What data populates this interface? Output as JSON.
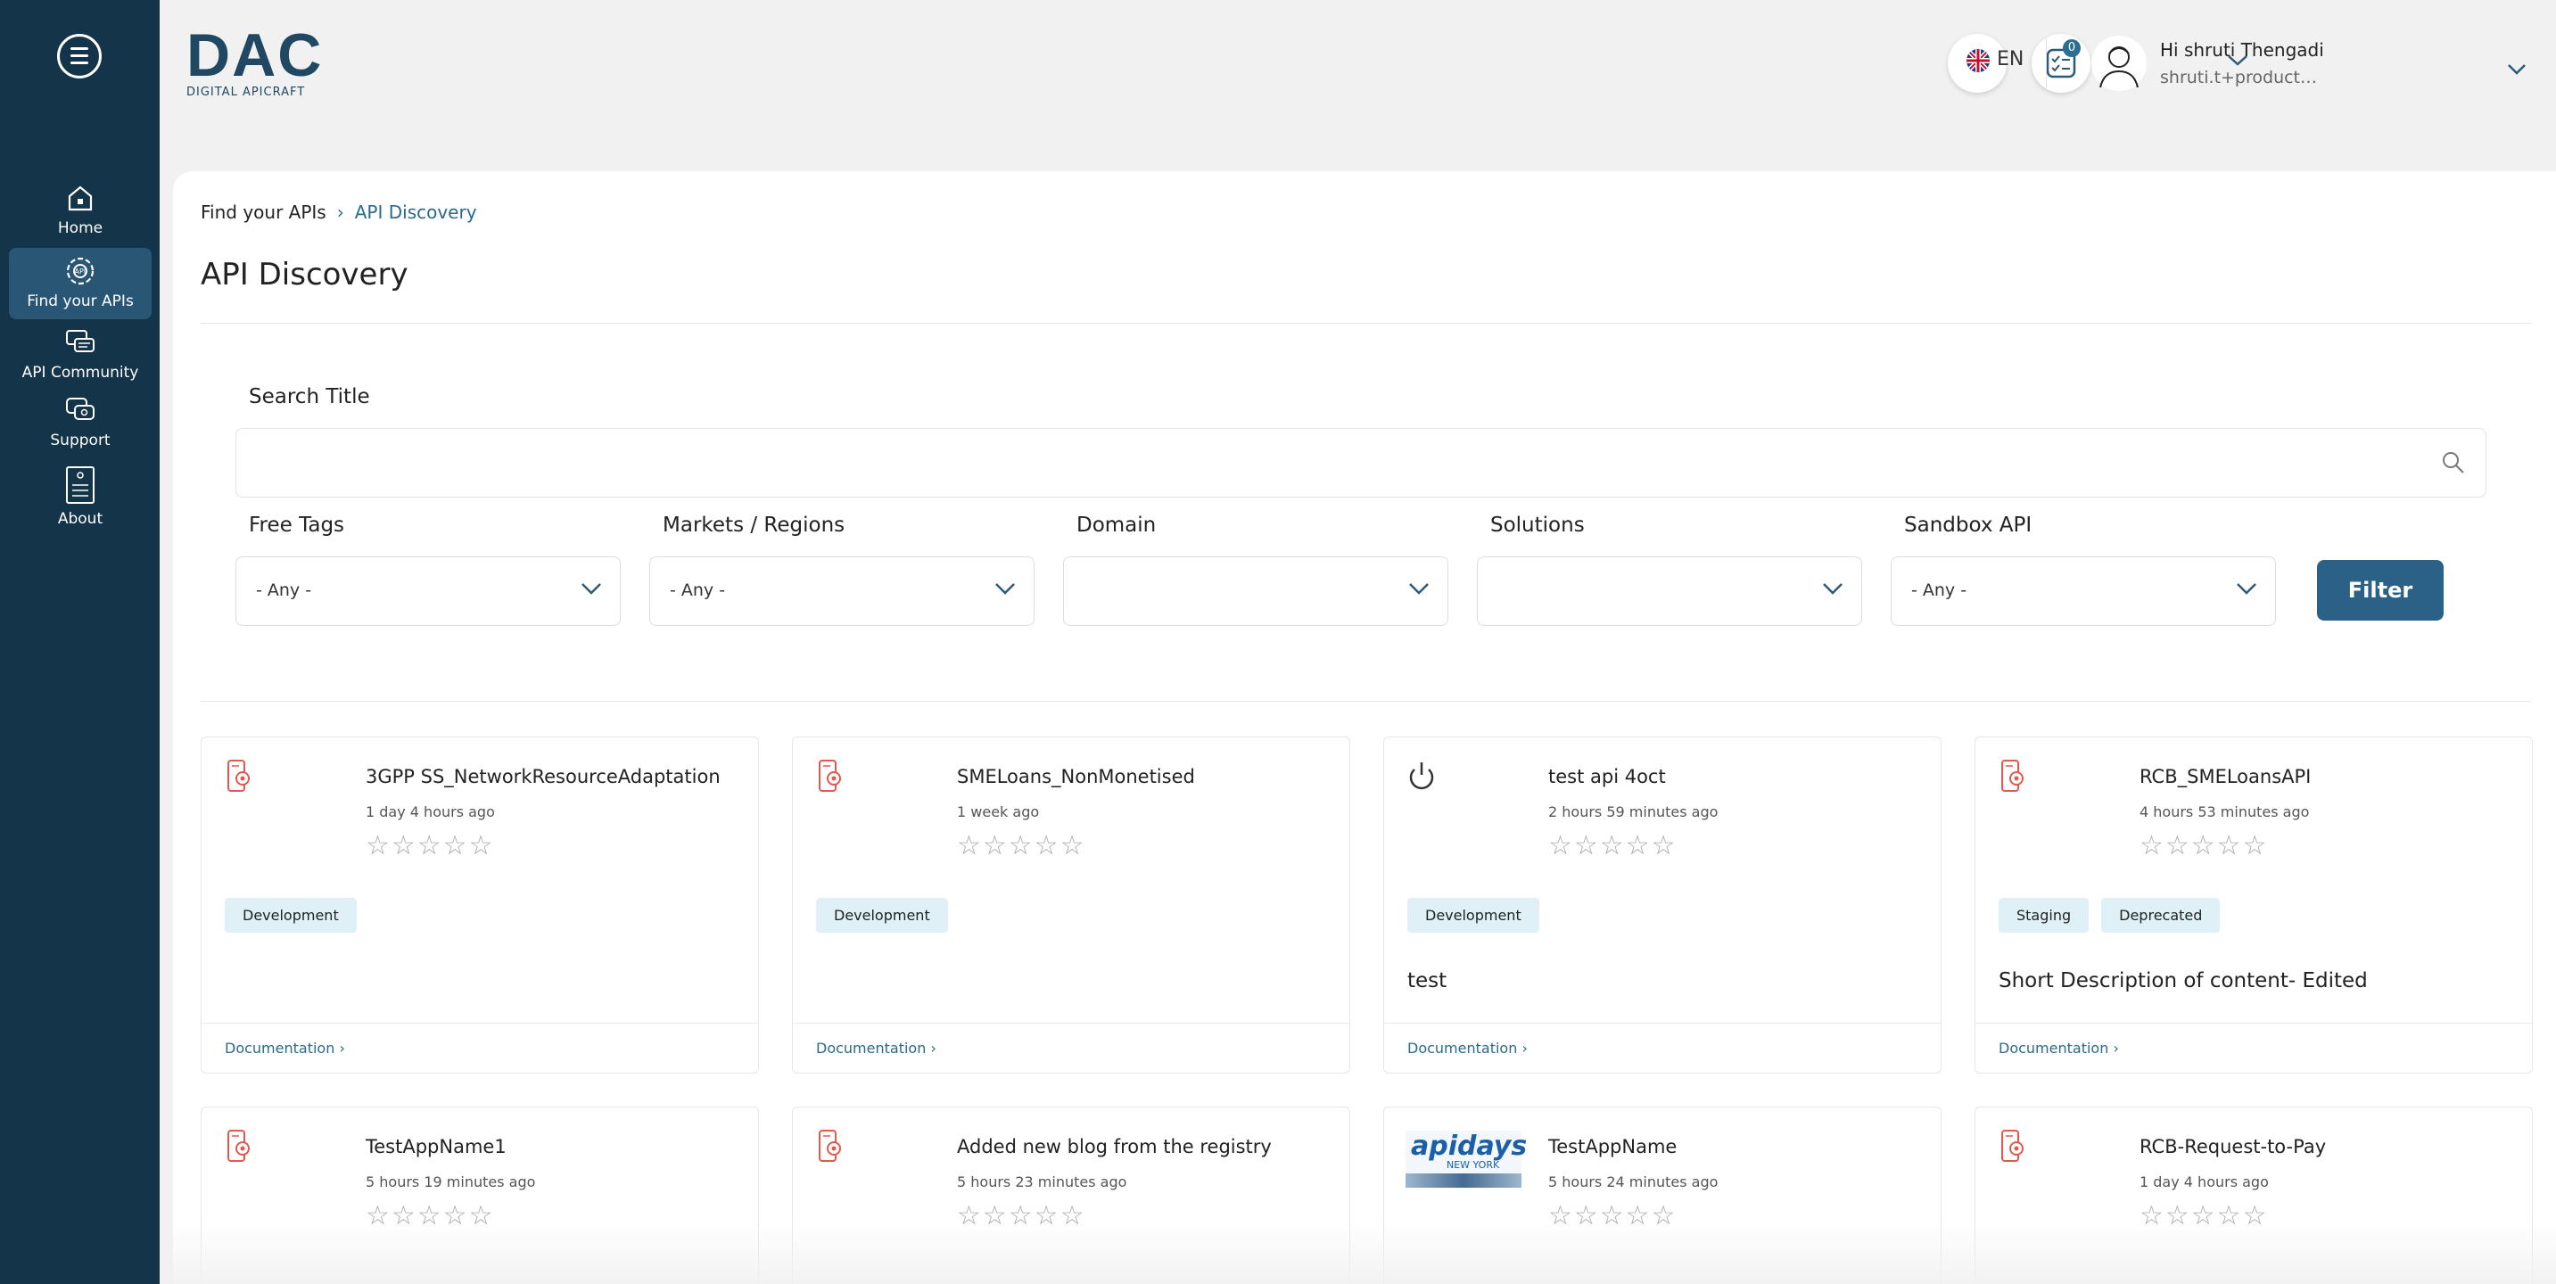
{
  "sidebar": {
    "items": [
      {
        "label": "Home",
        "icon": "home-icon"
      },
      {
        "label": "Find your APIs",
        "icon": "api-search-icon",
        "active": true
      },
      {
        "label": "API Community",
        "icon": "chat-icon"
      },
      {
        "label": "Support",
        "icon": "support-icon"
      },
      {
        "label": "About",
        "icon": "about-icon"
      }
    ]
  },
  "header": {
    "logo": {
      "big": "DAC",
      "small": "DIGITAL APICRAFT"
    },
    "notification_count": "0",
    "language": "EN",
    "user_name": "Hi shruti Thengadi",
    "user_email": "shruti.t+productm..."
  },
  "breadcrumb": {
    "parent": "Find your APIs",
    "current": "API Discovery"
  },
  "page_title": "API Discovery",
  "search": {
    "label": "Search Title",
    "placeholder": ""
  },
  "filters": [
    {
      "label": "Free Tags",
      "value": "- Any -"
    },
    {
      "label": "Markets / Regions",
      "value": "- Any -"
    },
    {
      "label": "Domain",
      "value": ""
    },
    {
      "label": "Solutions",
      "value": ""
    },
    {
      "label": "Sandbox API",
      "value": "- Any -"
    }
  ],
  "filter_button": "Filter",
  "doc_link": "Documentation",
  "cards": [
    {
      "title": "3GPP SS_NetworkResourceAdaptation",
      "time": "1 day 4 hours ago",
      "tags": [
        "Development"
      ],
      "desc": "",
      "icon": "app-icon"
    },
    {
      "title": "SMELoans_NonMonetised",
      "time": "1 week ago",
      "tags": [
        "Development"
      ],
      "desc": "",
      "icon": "app-icon"
    },
    {
      "title": "test api 4oct",
      "time": "2 hours 59 minutes ago",
      "tags": [
        "Development"
      ],
      "desc": "test",
      "icon": "power-icon"
    },
    {
      "title": "RCB_SMELoansAPI",
      "time": "4 hours 53 minutes ago",
      "tags": [
        "Staging",
        "Deprecated"
      ],
      "desc": "Short Description of content- Edited",
      "icon": "app-icon"
    },
    {
      "title": "TestAppName1",
      "time": "5 hours 19 minutes ago",
      "tags": [],
      "desc": "",
      "icon": "app-icon"
    },
    {
      "title": "Added new blog from the registry",
      "time": "5 hours 23 minutes ago",
      "tags": [],
      "desc": "",
      "icon": "app-icon"
    },
    {
      "title": "TestAppName",
      "time": "5 hours 24 minutes ago",
      "tags": [],
      "desc": "",
      "icon": "apidays-logo"
    },
    {
      "title": "RCB-Request-to-Pay",
      "time": "1 day 4 hours ago",
      "tags": [],
      "desc": "",
      "icon": "app-icon"
    }
  ],
  "apidays": {
    "t1": "apidays",
    "t2": "NEW YORK"
  },
  "stars_text": "☆☆☆☆☆",
  "colors": {
    "sidebar": "#14344a",
    "accent": "#2b6186",
    "tag_bg": "#dff1f7"
  }
}
